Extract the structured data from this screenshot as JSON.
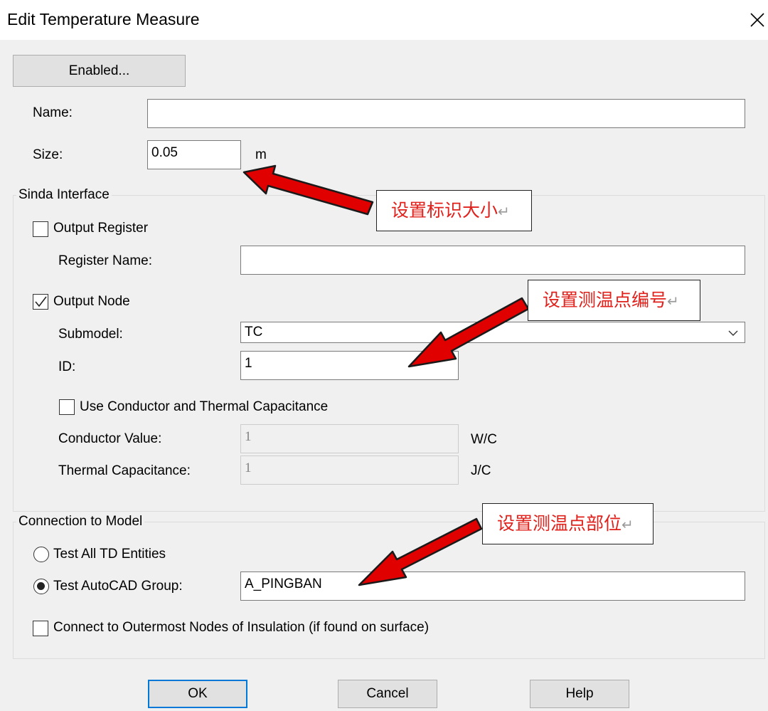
{
  "window": {
    "title": "Edit Temperature Measure"
  },
  "buttons": {
    "enabled": "Enabled...",
    "ok": "OK",
    "cancel": "Cancel",
    "help": "Help"
  },
  "fields": {
    "name_label": "Name:",
    "name_value": "",
    "size_label": "Size:",
    "size_value": "0.05",
    "size_unit": "m"
  },
  "sinda": {
    "title": "Sinda Interface",
    "output_register": {
      "label": "Output Register",
      "checked": false
    },
    "register_name_label": "Register Name:",
    "register_name_value": "",
    "output_node": {
      "label": "Output Node",
      "checked": true
    },
    "submodel_label": "Submodel:",
    "submodel_value": "TC",
    "id_label": "ID:",
    "id_value": "1",
    "use_conductor": {
      "label": "Use Conductor and Thermal Capacitance",
      "checked": false
    },
    "conductor_label": "Conductor Value:",
    "conductor_value": "1",
    "conductor_unit": "W/C",
    "capacitance_label": "Thermal Capacitance:",
    "capacitance_value": "1",
    "capacitance_unit": "J/C"
  },
  "connection": {
    "title": "Connection to Model",
    "test_all": {
      "label": "Test All TD Entities",
      "selected": false
    },
    "test_group": {
      "label": "Test AutoCAD Group:",
      "selected": true
    },
    "group_value": "A_PINGBAN",
    "outermost": {
      "label": "Connect to Outermost Nodes of Insulation (if found on surface)",
      "checked": false
    }
  },
  "annotations": {
    "size_note": "设置标识大小",
    "id_note": "设置测温点编号",
    "group_note": "设置测温点部位",
    "return_mark": "↵",
    "arrow_color": "#e00000"
  },
  "icons": {
    "close": "close-icon",
    "dropdown": "chevron-down-icon",
    "check": "check-icon"
  }
}
